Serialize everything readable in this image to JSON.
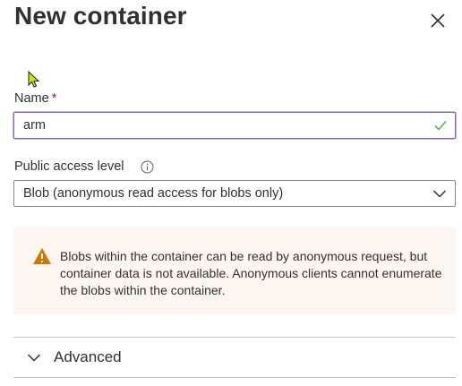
{
  "panel": {
    "title": "New container",
    "close_icon": "close-icon"
  },
  "name_field": {
    "label": "Name",
    "required_marker": "*",
    "value": "arm",
    "status_icon": "checkmark-icon",
    "status_color": "#5db34a"
  },
  "access_level": {
    "label": "Public access level",
    "info_icon": "info-icon",
    "selected": "Blob (anonymous read access for blobs only)",
    "dropdown_icon": "chevron-down-icon"
  },
  "warning": {
    "icon": "warning-triangle-icon",
    "icon_color": "#d47500",
    "text": "Blobs within the container can be read by anonymous request, but container data is not available. Anonymous clients cannot enumerate the blobs within the container."
  },
  "advanced": {
    "label": "Advanced",
    "icon": "chevron-down-icon"
  },
  "colors": {
    "focus_border": "#8764b8",
    "required": "#a4262c",
    "warning_bg": "#fdf6f1"
  }
}
